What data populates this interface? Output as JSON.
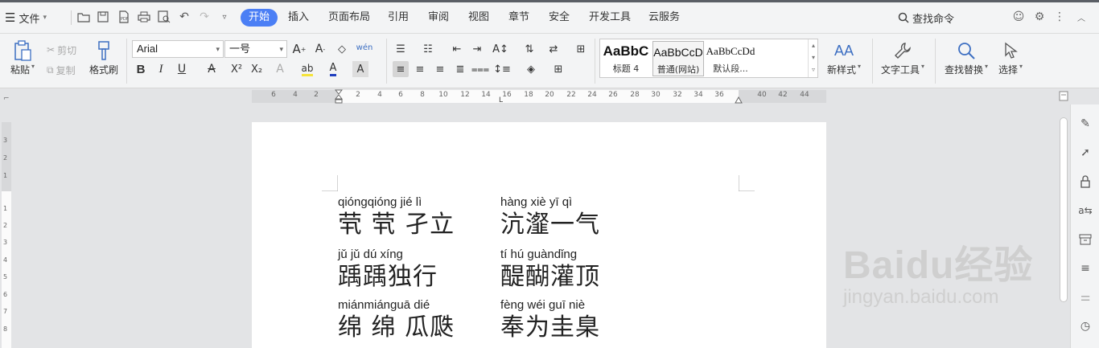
{
  "menubar": {
    "file_label": "文件",
    "tabs": [
      "开始",
      "插入",
      "页面布局",
      "引用",
      "审阅",
      "视图",
      "章节",
      "安全",
      "开发工具",
      "云服务"
    ],
    "active_tab": "开始",
    "search_label": "查找命令"
  },
  "ribbon": {
    "paste_label": "粘贴",
    "cut_label": "剪切",
    "copy_label": "复制",
    "format_painter_label": "格式刷",
    "font_name": "Arial",
    "font_size": "一号",
    "styles": [
      {
        "sample": "AaBbC",
        "name": "标题 4"
      },
      {
        "sample": "AaBbCcD",
        "name": "普通(网站)"
      },
      {
        "sample": "AaBbCcDd",
        "name": "默认段..."
      }
    ],
    "new_style_label": "新样式",
    "text_tools_label": "文字工具",
    "find_replace_label": "查找替换",
    "select_label": "选择",
    "colors": {
      "accent": "#4b7ff5",
      "font_color": "#1f3fbf",
      "highlight": "#f5e33a"
    }
  },
  "ruler": {
    "ticks": [
      "6",
      "4",
      "2",
      "2",
      "4",
      "6",
      "8",
      "10",
      "12",
      "14",
      "16",
      "18",
      "20",
      "22",
      "24",
      "26",
      "28",
      "30",
      "32",
      "34",
      "36",
      "40",
      "42",
      "44"
    ]
  },
  "vruler": {
    "ticks": [
      "3",
      "2",
      "1",
      "1",
      "2",
      "3",
      "4",
      "5",
      "6",
      "7",
      "8"
    ]
  },
  "document": {
    "words": [
      {
        "pinyin": "qióngqióng jié   lì",
        "hanzi": "茕 茕 孑立"
      },
      {
        "pinyin": "hàng xiè   yī   qì",
        "hanzi": "沆瀣一气"
      },
      {
        "pinyin": "jǔ   jǔ    dú xíng",
        "hanzi": "踽踽独行"
      },
      {
        "pinyin": "tí   hú guàndǐng",
        "hanzi": "醍醐灌顶"
      },
      {
        "pinyin": "miánmiánguā dié",
        "hanzi": "绵 绵 瓜瓞"
      },
      {
        "pinyin": "fèng wéi  guī  niè",
        "hanzi": "奉为圭臬"
      }
    ]
  },
  "watermark": {
    "logo": "Baidu经验",
    "url": "jingyan.baidu.com"
  }
}
